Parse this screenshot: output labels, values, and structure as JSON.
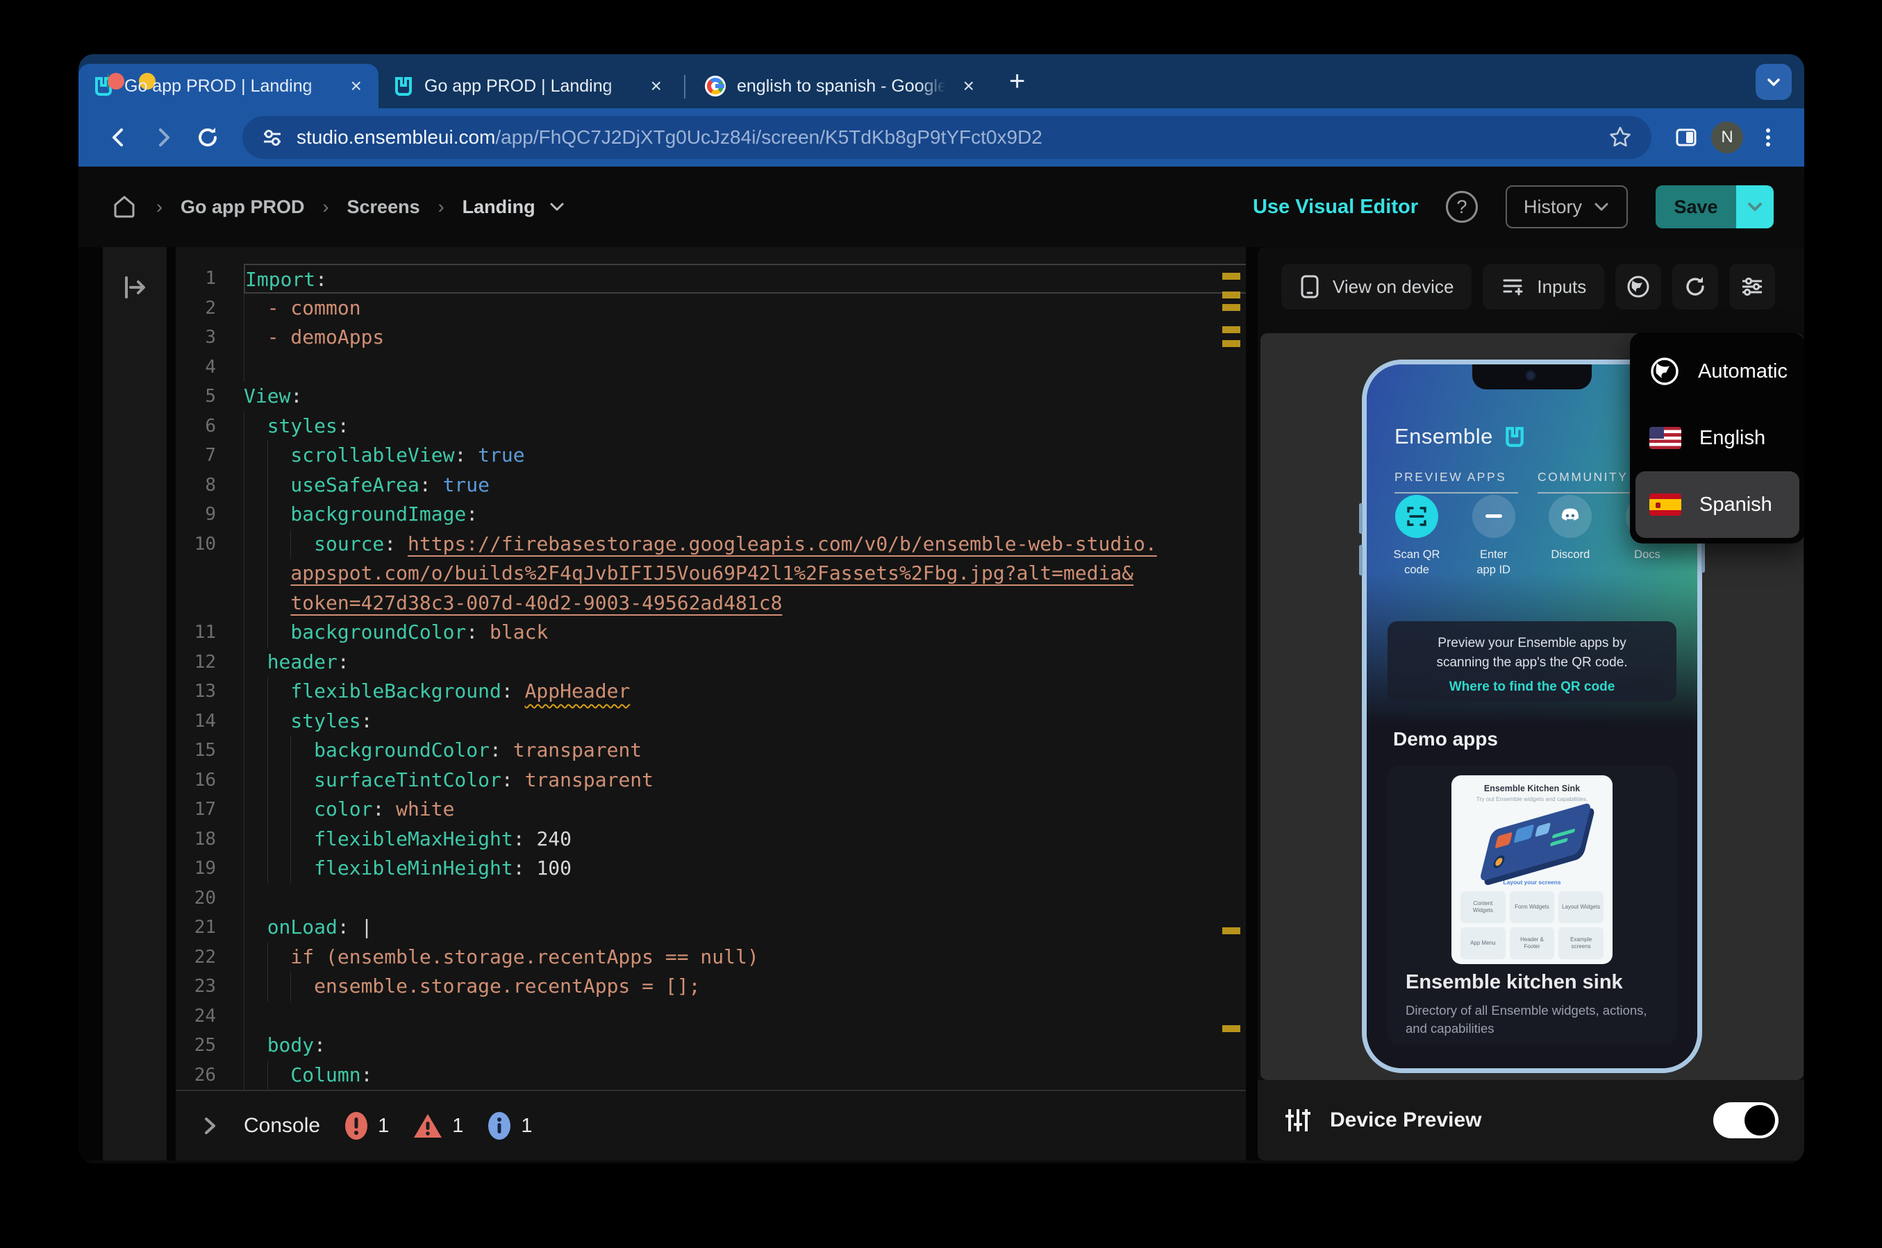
{
  "colors": {
    "accent": "#38e1e4",
    "save_teal": "#1f7c79",
    "code_key": "#3fc9a9",
    "code_value": "#d08f74",
    "code_bool": "#5b9bd8",
    "marker_yellow": "#b8941c",
    "link_teal": "#2fd9cb",
    "qr_circle": "#23d7e5"
  },
  "browser": {
    "tabs": [
      {
        "title": "Go app PROD | Landing",
        "favicon": "ensemble-logo"
      },
      {
        "title": "Go app PROD | Landing",
        "favicon": "ensemble-logo"
      },
      {
        "title": "english to spanish - Google S",
        "favicon": "google-logo"
      }
    ],
    "url_host": "studio.ensembleui.com",
    "url_path": "/app/FhQC7J2DjXTg0UcJz84i/screen/K5TdKb8gP9tYFct0x9D2",
    "avatar": "N"
  },
  "header": {
    "breadcrumb": [
      "Go app PROD",
      "Screens",
      "Landing"
    ],
    "use_visual_editor": "Use Visual Editor",
    "history": "History",
    "save": "Save"
  },
  "editor": {
    "console": {
      "label": "Console",
      "errors": "1",
      "warnings": "1",
      "infos": "1"
    },
    "ruler_marks": [
      37,
      64,
      82,
      114,
      134,
      980,
      1121
    ],
    "lines": [
      {
        "n": "1",
        "ind": 0,
        "g": 0,
        "hl": true,
        "seg": [
          [
            "k",
            "Import"
          ],
          [
            "p",
            ":"
          ]
        ]
      },
      {
        "n": "2",
        "ind": 2,
        "g": 1,
        "seg": [
          [
            "v",
            "- common"
          ]
        ]
      },
      {
        "n": "3",
        "ind": 2,
        "g": 1,
        "seg": [
          [
            "v",
            "- demoApps"
          ]
        ]
      },
      {
        "n": "4",
        "ind": 0,
        "g": 1,
        "seg": []
      },
      {
        "n": "5",
        "ind": 0,
        "g": 0,
        "seg": [
          [
            "k",
            "View"
          ],
          [
            "p",
            ":"
          ]
        ]
      },
      {
        "n": "6",
        "ind": 2,
        "g": 1,
        "seg": [
          [
            "k",
            "styles"
          ],
          [
            "p",
            ":"
          ]
        ]
      },
      {
        "n": "7",
        "ind": 4,
        "g": 2,
        "seg": [
          [
            "k",
            "scrollableView"
          ],
          [
            "p",
            ": "
          ],
          [
            "b",
            "true"
          ]
        ]
      },
      {
        "n": "8",
        "ind": 4,
        "g": 2,
        "seg": [
          [
            "k",
            "useSafeArea"
          ],
          [
            "p",
            ": "
          ],
          [
            "b",
            "true"
          ]
        ]
      },
      {
        "n": "9",
        "ind": 4,
        "g": 2,
        "seg": [
          [
            "k",
            "backgroundImage"
          ],
          [
            "p",
            ":"
          ]
        ]
      },
      {
        "n": "10",
        "ind": 6,
        "g": 3,
        "seg": [
          [
            "k",
            "source"
          ],
          [
            "p",
            ": "
          ],
          [
            "u",
            "https://firebasestorage.googleapis.com/v0/b/ensemble-web-studio."
          ]
        ]
      },
      {
        "n": "",
        "ind": 4,
        "g": 2,
        "seg": [
          [
            "u",
            "appspot.com/o/builds%2F4qJvbIFIJ5Vou69P42l1%2Fassets%2Fbg.jpg?alt=media&"
          ]
        ]
      },
      {
        "n": "",
        "ind": 4,
        "g": 2,
        "seg": [
          [
            "u",
            "token=427d38c3-007d-40d2-9003-49562ad481c8"
          ]
        ]
      },
      {
        "n": "11",
        "ind": 4,
        "g": 2,
        "seg": [
          [
            "k",
            "backgroundColor"
          ],
          [
            "p",
            ": "
          ],
          [
            "v",
            "black"
          ]
        ]
      },
      {
        "n": "12",
        "ind": 2,
        "g": 1,
        "seg": [
          [
            "k",
            "header"
          ],
          [
            "p",
            ":"
          ]
        ]
      },
      {
        "n": "13",
        "ind": 4,
        "g": 2,
        "seg": [
          [
            "k",
            "flexibleBackground"
          ],
          [
            "p",
            ": "
          ],
          [
            "w",
            "AppHeader"
          ]
        ]
      },
      {
        "n": "14",
        "ind": 4,
        "g": 2,
        "seg": [
          [
            "k",
            "styles"
          ],
          [
            "p",
            ":"
          ]
        ]
      },
      {
        "n": "15",
        "ind": 6,
        "g": 3,
        "seg": [
          [
            "k",
            "backgroundColor"
          ],
          [
            "p",
            ": "
          ],
          [
            "v",
            "transparent"
          ]
        ]
      },
      {
        "n": "16",
        "ind": 6,
        "g": 3,
        "seg": [
          [
            "k",
            "surfaceTintColor"
          ],
          [
            "p",
            ": "
          ],
          [
            "v",
            "transparent"
          ]
        ]
      },
      {
        "n": "17",
        "ind": 6,
        "g": 3,
        "seg": [
          [
            "k",
            "color"
          ],
          [
            "p",
            ": "
          ],
          [
            "v",
            "white"
          ]
        ]
      },
      {
        "n": "18",
        "ind": 6,
        "g": 3,
        "seg": [
          [
            "k",
            "flexibleMaxHeight"
          ],
          [
            "p",
            ": "
          ],
          [
            "n",
            "240"
          ]
        ]
      },
      {
        "n": "19",
        "ind": 6,
        "g": 3,
        "seg": [
          [
            "k",
            "flexibleMinHeight"
          ],
          [
            "p",
            ": "
          ],
          [
            "n",
            "100"
          ]
        ]
      },
      {
        "n": "20",
        "ind": 0,
        "g": 1,
        "seg": []
      },
      {
        "n": "21",
        "ind": 2,
        "g": 1,
        "seg": [
          [
            "k",
            "onLoad"
          ],
          [
            "p",
            ": "
          ],
          [
            "s",
            "|"
          ]
        ]
      },
      {
        "n": "22",
        "ind": 4,
        "g": 2,
        "seg": [
          [
            "v",
            "if (ensemble.storage.recentApps == null)"
          ]
        ]
      },
      {
        "n": "23",
        "ind": 6,
        "g": 3,
        "seg": [
          [
            "v",
            "ensemble.storage.recentApps = [];"
          ]
        ]
      },
      {
        "n": "24",
        "ind": 0,
        "g": 1,
        "seg": []
      },
      {
        "n": "25",
        "ind": 2,
        "g": 1,
        "seg": [
          [
            "k",
            "body"
          ],
          [
            "p",
            ":"
          ]
        ]
      },
      {
        "n": "26",
        "ind": 4,
        "g": 2,
        "seg": [
          [
            "k",
            "Column"
          ],
          [
            "p",
            ":"
          ]
        ]
      }
    ]
  },
  "preview": {
    "toolbar": {
      "view_on_device": "View on device",
      "inputs": "Inputs"
    },
    "dropdown": {
      "items": [
        {
          "label": "Automatic",
          "icon": "globe-icon"
        },
        {
          "label": "English",
          "icon": "us-flag-icon"
        },
        {
          "label": "Spanish",
          "icon": "es-flag-icon",
          "selected": true
        }
      ]
    },
    "phone": {
      "app_name": "Ensemble",
      "section_preview": "PREVIEW APPS",
      "section_community": "COMMUNITY &",
      "actions": [
        {
          "label": "Scan QR\ncode",
          "icon": "qr-scan-icon",
          "style": "accent"
        },
        {
          "label": "Enter\napp ID",
          "icon": "dash-icon",
          "style": "dim"
        },
        {
          "label": "Discord",
          "icon": "discord-icon",
          "style": "dim"
        },
        {
          "label": "Docs",
          "icon": "docs-icon",
          "style": "dim"
        }
      ],
      "card_text": "Preview your Ensemble apps by scanning the app's the QR code.",
      "card_link": "Where to find the QR code",
      "demo_heading": "Demo apps",
      "kitchen": {
        "title": "Ensemble Kitchen Sink",
        "subtitle": "Try out Ensemble widgets and capabilities.",
        "layout_label": "Layout your screens",
        "tiles": [
          "Content Widgets",
          "Form Widgets",
          "Layout Widgets",
          "App Menu",
          "Header & Footer",
          "Example screens"
        ],
        "name": "Ensemble kitchen sink",
        "description": "Directory of all Ensemble widgets, actions, and capabilities"
      }
    },
    "bottom": {
      "label": "Device Preview",
      "toggle_on": true
    }
  }
}
